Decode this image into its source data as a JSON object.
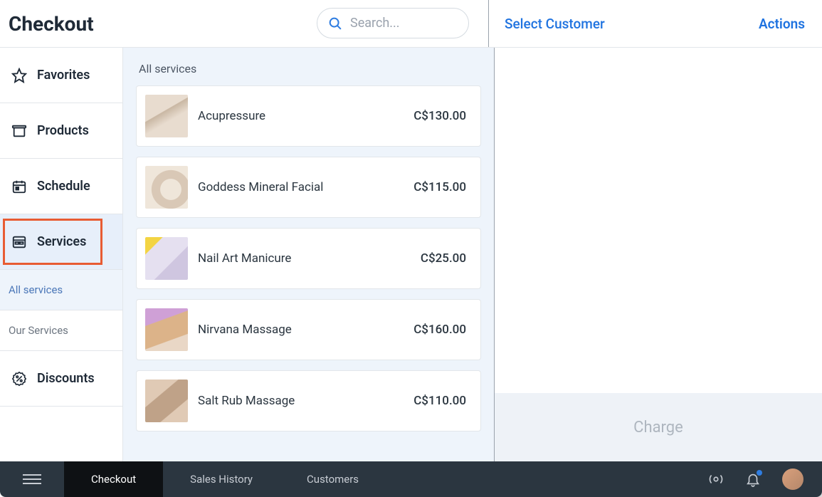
{
  "header": {
    "title": "Checkout",
    "search_placeholder": "Search...",
    "select_customer": "Select Customer",
    "actions": "Actions"
  },
  "sidebar": {
    "items": [
      {
        "label": "Favorites"
      },
      {
        "label": "Products"
      },
      {
        "label": "Schedule"
      },
      {
        "label": "Services"
      },
      {
        "label": "Discounts"
      }
    ],
    "sub_items": [
      {
        "label": "All services"
      },
      {
        "label": "Our Services"
      }
    ]
  },
  "services": {
    "heading": "All services",
    "items": [
      {
        "name": "Acupressure",
        "price": "C$130.00"
      },
      {
        "name": "Goddess Mineral Facial",
        "price": "C$115.00"
      },
      {
        "name": "Nail Art Manicure",
        "price": "C$25.00"
      },
      {
        "name": "Nirvana Massage",
        "price": "C$160.00"
      },
      {
        "name": "Salt Rub Massage",
        "price": "C$110.00"
      }
    ]
  },
  "cart": {
    "charge_label": "Charge"
  },
  "bottom": {
    "tabs": [
      {
        "label": "Checkout"
      },
      {
        "label": "Sales History"
      },
      {
        "label": "Customers"
      }
    ]
  }
}
